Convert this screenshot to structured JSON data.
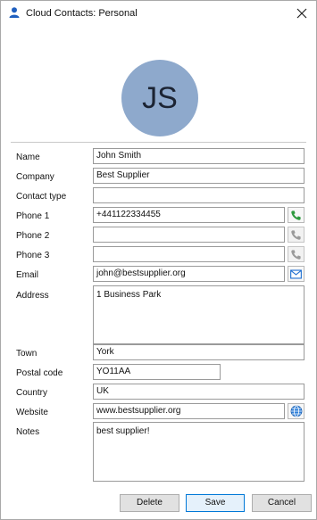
{
  "window": {
    "title": "Cloud Contacts: Personal"
  },
  "avatar": {
    "initials": "JS"
  },
  "form": {
    "name": {
      "label": "Name",
      "value": "John Smith"
    },
    "company": {
      "label": "Company",
      "value": "Best Supplier"
    },
    "contact_type": {
      "label": "Contact type",
      "value": ""
    },
    "phone1": {
      "label": "Phone 1",
      "value": "+441122334455"
    },
    "phone2": {
      "label": "Phone 2",
      "value": ""
    },
    "phone3": {
      "label": "Phone 3",
      "value": ""
    },
    "email": {
      "label": "Email",
      "value": "john@bestsupplier.org"
    },
    "address": {
      "label": "Address",
      "value": "1 Business Park"
    },
    "town": {
      "label": "Town",
      "value": "York"
    },
    "postal_code": {
      "label": "Postal code",
      "value": "YO11AA"
    },
    "country": {
      "label": "Country",
      "value": "UK"
    },
    "website": {
      "label": "Website",
      "value": "www.bestsupplier.org"
    },
    "notes": {
      "label": "Notes",
      "value": "best supplier!"
    }
  },
  "buttons": {
    "delete": "Delete",
    "save": "Save",
    "cancel": "Cancel"
  },
  "icons": {
    "phone1": "phone-icon-green",
    "phone2": "phone-icon-gray",
    "phone3": "phone-icon-gray",
    "email": "mail-icon",
    "website": "globe-icon"
  },
  "colors": {
    "avatar_bg": "#8ea9cc",
    "phone_active": "#2e9a3e",
    "phone_inactive": "#9a9a9a",
    "accent": "#0078d7"
  }
}
